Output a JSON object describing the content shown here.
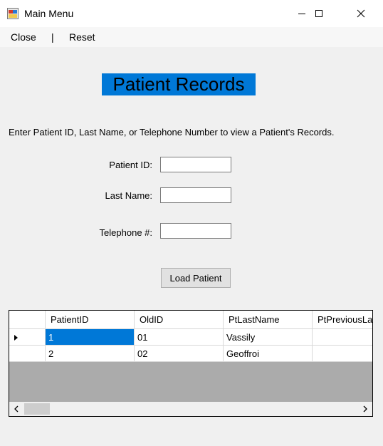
{
  "window": {
    "title": "Main Menu",
    "controls": [
      "minimize-icon",
      "maximize-icon",
      "close-icon"
    ]
  },
  "menu": {
    "close": "Close",
    "separator": "|",
    "reset": "Reset"
  },
  "heading": "Patient Records",
  "instructions": "Enter Patient ID, Last Name, or Telephone Number to view a Patient's Records.",
  "form": {
    "patient_id_label": "Patient ID:",
    "patient_id_value": "",
    "last_name_label": "Last Name:",
    "last_name_value": "",
    "telephone_label": "Telephone #:",
    "telephone_value": "",
    "load_button": "Load Patient"
  },
  "grid": {
    "columns": [
      "PatientID",
      "OldID",
      "PtLastName",
      "PtPreviousLa"
    ],
    "rows": [
      {
        "cells": [
          "1",
          "01",
          "Vassily",
          ""
        ],
        "current": true,
        "selected_col": 0
      },
      {
        "cells": [
          "2",
          "02",
          "Geoffroi",
          ""
        ],
        "current": false
      }
    ],
    "icons": [
      "current-row-arrow-icon",
      "scroll-left-icon",
      "scroll-right-icon"
    ]
  },
  "colors": {
    "heading_bg": "#0078d7",
    "selection": "#0078d7",
    "grid_empty": "#ababab"
  }
}
